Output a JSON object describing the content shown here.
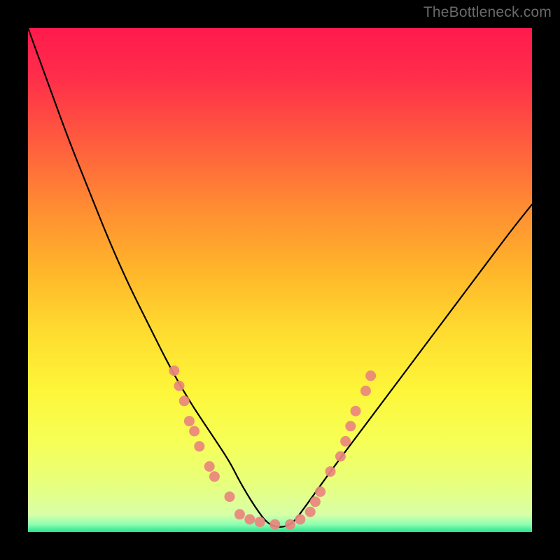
{
  "watermark": "TheBottleneck.com",
  "chart_data": {
    "type": "line",
    "title": "",
    "xlabel": "",
    "ylabel": "",
    "xlim": [
      0,
      100
    ],
    "ylim": [
      0,
      100
    ],
    "curve": {
      "description": "V-shaped bottleneck curve over rainbow vertical gradient",
      "x": [
        0,
        4,
        8,
        12,
        16,
        20,
        24,
        28,
        32,
        36,
        40,
        42,
        45,
        48,
        52,
        55,
        60,
        66,
        72,
        78,
        84,
        90,
        96,
        100
      ],
      "y": [
        100,
        89,
        78,
        68,
        58,
        49,
        41,
        33,
        26,
        20,
        14,
        10,
        5,
        1,
        1,
        5,
        12,
        20,
        28,
        36,
        44,
        52,
        60,
        65
      ]
    },
    "green_band": {
      "top": 3.5,
      "bottom": 0
    },
    "markers": {
      "description": "Coral/pink circular markers scattered near the valley of the V-curve",
      "points": [
        {
          "x": 29,
          "y": 32
        },
        {
          "x": 30,
          "y": 29
        },
        {
          "x": 31,
          "y": 26
        },
        {
          "x": 32,
          "y": 22
        },
        {
          "x": 33,
          "y": 20
        },
        {
          "x": 34,
          "y": 17
        },
        {
          "x": 36,
          "y": 13
        },
        {
          "x": 37,
          "y": 11
        },
        {
          "x": 40,
          "y": 7
        },
        {
          "x": 42,
          "y": 3.5
        },
        {
          "x": 44,
          "y": 2.5
        },
        {
          "x": 46,
          "y": 2
        },
        {
          "x": 49,
          "y": 1.5
        },
        {
          "x": 52,
          "y": 1.5
        },
        {
          "x": 54,
          "y": 2.5
        },
        {
          "x": 56,
          "y": 4
        },
        {
          "x": 57,
          "y": 6
        },
        {
          "x": 58,
          "y": 8
        },
        {
          "x": 60,
          "y": 12
        },
        {
          "x": 62,
          "y": 15
        },
        {
          "x": 63,
          "y": 18
        },
        {
          "x": 64,
          "y": 21
        },
        {
          "x": 65,
          "y": 24
        },
        {
          "x": 67,
          "y": 28
        },
        {
          "x": 68,
          "y": 31
        }
      ]
    },
    "gradient_stops": [
      {
        "offset": 0.0,
        "color": "#ff1a4d"
      },
      {
        "offset": 0.1,
        "color": "#ff2e4a"
      },
      {
        "offset": 0.22,
        "color": "#ff5a3f"
      },
      {
        "offset": 0.35,
        "color": "#ff8a33"
      },
      {
        "offset": 0.48,
        "color": "#ffb52a"
      },
      {
        "offset": 0.6,
        "color": "#ffdb2f"
      },
      {
        "offset": 0.72,
        "color": "#fdf639"
      },
      {
        "offset": 0.82,
        "color": "#f6ff56"
      },
      {
        "offset": 0.9,
        "color": "#e8ff7a"
      },
      {
        "offset": 0.965,
        "color": "#d8ffa6"
      },
      {
        "offset": 0.985,
        "color": "#8effb2"
      },
      {
        "offset": 1.0,
        "color": "#25e28d"
      }
    ]
  }
}
